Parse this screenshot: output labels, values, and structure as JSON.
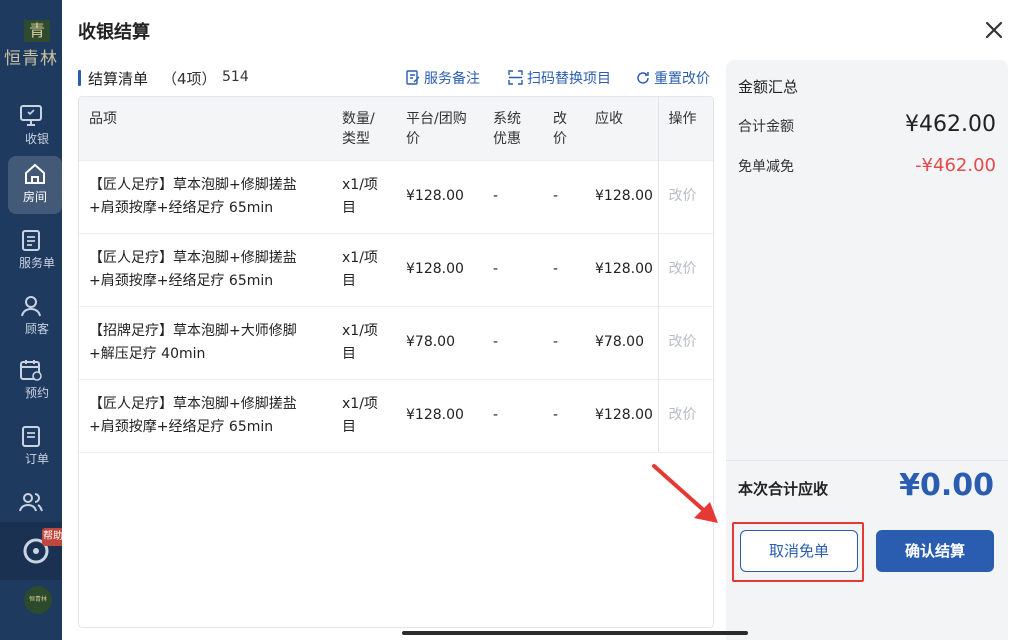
{
  "sidebar": {
    "logo_text": "恒青林",
    "logo_mark": "青",
    "items": [
      {
        "label": "收银"
      },
      {
        "label": "房间"
      },
      {
        "label": "服务单"
      },
      {
        "label": "顾客"
      },
      {
        "label": "预约"
      },
      {
        "label": "订单"
      }
    ],
    "badge": "帮助",
    "avatar_text": "恒青林"
  },
  "modal": {
    "title": "收银结算",
    "close_icon": "close-icon"
  },
  "list": {
    "title": "结算清单",
    "count": "（4项）",
    "code": "514",
    "actions": {
      "service_note": "服务备注",
      "scan_replace": "扫码替换项目",
      "reset_price": "重置改价"
    },
    "columns": {
      "item": "品项",
      "qty_type": "数量/类型",
      "platform_price": "平台/团购价",
      "system_discount": "系统优惠",
      "adjust": "改价",
      "receivable": "应收",
      "operation": "操作"
    },
    "rows": [
      {
        "name": "【匠人足疗】草本泡脚+修脚搓盐+肩颈按摩+经络足疗 65min",
        "qty": "x1/项目",
        "platform_price": "¥128.00",
        "system_discount": "-",
        "adjust": "-",
        "receivable": "¥128.00",
        "op": "改价"
      },
      {
        "name": "【匠人足疗】草本泡脚+修脚搓盐+肩颈按摩+经络足疗 65min",
        "qty": "x1/项目",
        "platform_price": "¥128.00",
        "system_discount": "-",
        "adjust": "-",
        "receivable": "¥128.00",
        "op": "改价"
      },
      {
        "name": "【招牌足疗】草本泡脚+大师修脚+解压足疗 40min",
        "qty": "x1/项目",
        "platform_price": "¥78.00",
        "system_discount": "-",
        "adjust": "-",
        "receivable": "¥78.00",
        "op": "改价"
      },
      {
        "name": "【匠人足疗】草本泡脚+修脚搓盐+肩颈按摩+经络足疗 65min",
        "qty": "x1/项目",
        "platform_price": "¥128.00",
        "system_discount": "-",
        "adjust": "-",
        "receivable": "¥128.00",
        "op": "改价"
      }
    ]
  },
  "summary": {
    "title": "金额汇总",
    "total_label": "合计金额",
    "total_value": "¥462.00",
    "waive_label": "免单减免",
    "waive_value": "-¥462.00",
    "due_label": "本次合计应收",
    "due_value": "¥0.00",
    "cancel_button": "取消免单",
    "confirm_button": "确认结算"
  },
  "colors": {
    "accent": "#2a5db0",
    "negative": "#e14b4b",
    "highlight": "#e53935",
    "sidebar": "#1f3a5f"
  }
}
